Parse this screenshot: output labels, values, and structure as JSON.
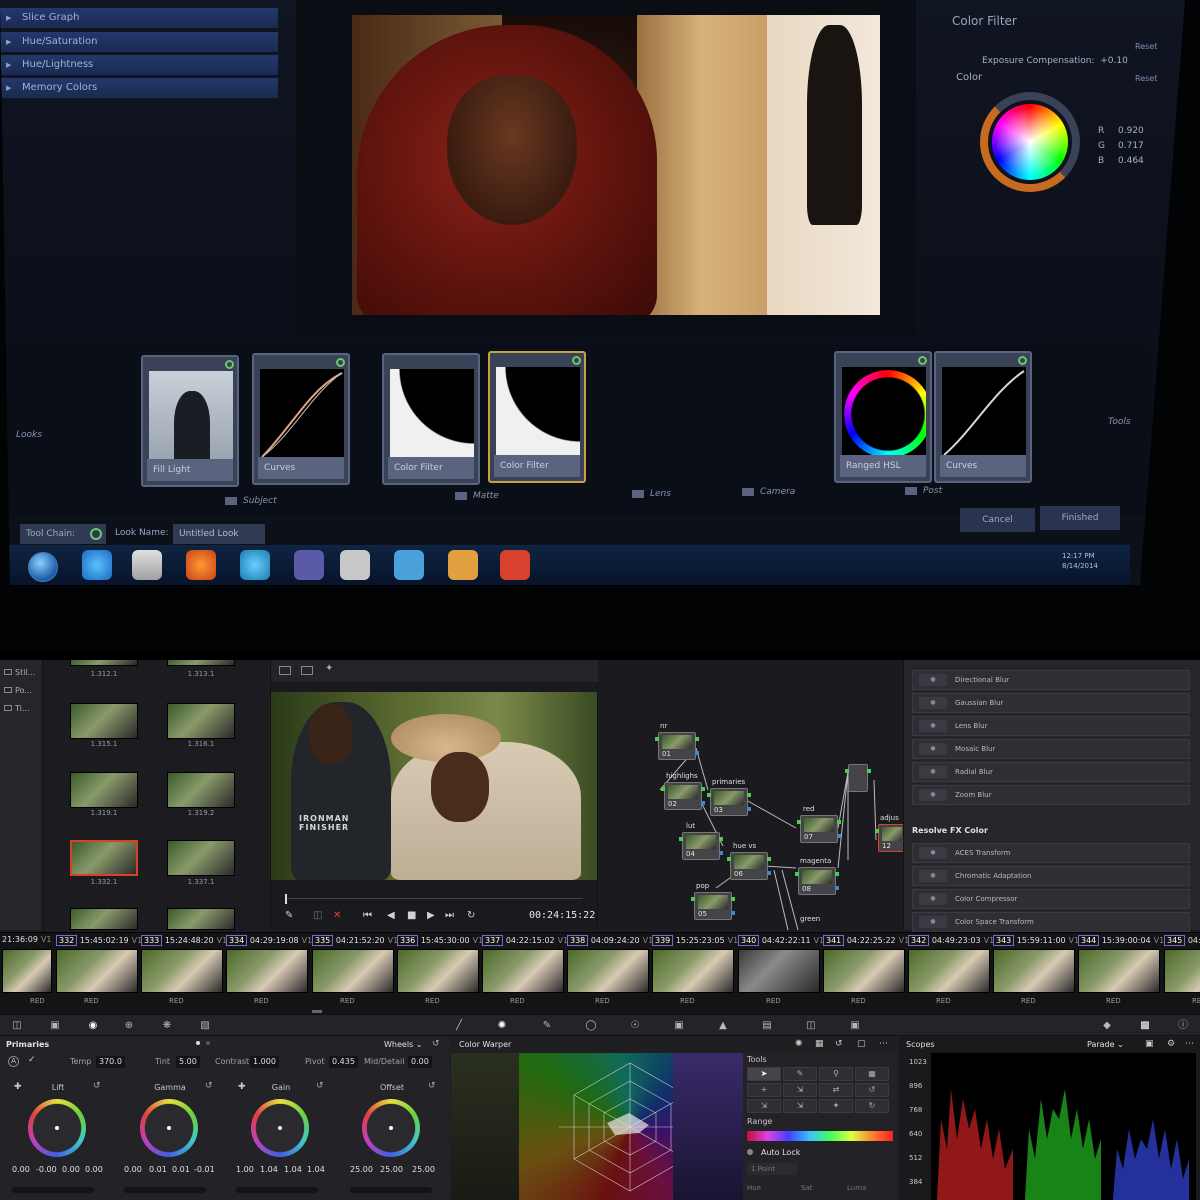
{
  "top_photo": {
    "sidebar_menu": [
      "Slice Graph",
      "Hue/Saturation",
      "Hue/Lightness",
      "Memory Colors"
    ],
    "color_filter": {
      "title": "Color Filter",
      "reset_label": "Reset",
      "exposure_label": "Exposure Compensation:",
      "exposure_value": "+0.10",
      "color_label": "Color",
      "r_label": "R",
      "r_value": "0.920",
      "g_label": "G",
      "g_value": "0.717",
      "b_label": "B",
      "b_value": "0.464"
    },
    "looks_label": "Looks",
    "tools_label": "Tools",
    "tool_cards": [
      "Fill Light",
      "Curves",
      "Color Filter",
      "Color Filter",
      "Ranged HSL",
      "Curves"
    ],
    "groups": [
      "Subject",
      "Matte",
      "Lens",
      "Camera",
      "Post"
    ],
    "tool_chain_label": "Tool Chain:",
    "look_name_label": "Look Name:",
    "look_name_value": "Untitled Look",
    "cancel_label": "Cancel",
    "finished_label": "Finished",
    "clock_time": "12:17 PM",
    "clock_date": "8/14/2014"
  },
  "resolve": {
    "gallery_tabs": [
      "Stil...",
      "Po...",
      "Ti..."
    ],
    "stills": [
      "1.312.1",
      "1.313.1",
      "1.315.1",
      "1.316.1",
      "1.319.1",
      "1.319.2",
      "1.332.1",
      "1.337.1"
    ],
    "viewer": {
      "shirt_text_1": "IRONMAN",
      "shirt_text_2": "FINISHER",
      "timecode": "00:24:15:22"
    },
    "nodes": [
      {
        "label": "nr",
        "num": "01"
      },
      {
        "label": "highlighs",
        "num": "02"
      },
      {
        "label": "primaries",
        "num": "03"
      },
      {
        "label": "lut",
        "num": "04"
      },
      {
        "label": "hue vs",
        "num": "06"
      },
      {
        "label": "pop",
        "num": "05"
      },
      {
        "label": "red",
        "num": "07"
      },
      {
        "label": "magenta",
        "num": "08"
      },
      {
        "label": "green",
        "num": ""
      },
      {
        "label": "adjus",
        "num": "12"
      }
    ],
    "fx_blur": [
      "Directional Blur",
      "Gaussian Blur",
      "Lens Blur",
      "Mosaic Blur",
      "Radial Blur",
      "Zoom Blur"
    ],
    "fx_heading": "Resolve FX Color",
    "fx_color": [
      "ACES Transform",
      "Chromatic Adaptation",
      "Color Compressor",
      "Color Space Transform"
    ],
    "timeline": {
      "first_tc": "21:36:09",
      "track": "V1",
      "codec": "RED",
      "clips": [
        {
          "num": "332",
          "tc": "15:45:02:19"
        },
        {
          "num": "333",
          "tc": "15:24:48:20"
        },
        {
          "num": "334",
          "tc": "04:29:19:08"
        },
        {
          "num": "335",
          "tc": "04:21:52:20"
        },
        {
          "num": "336",
          "tc": "15:45:30:00"
        },
        {
          "num": "337",
          "tc": "04:22:15:02"
        },
        {
          "num": "338",
          "tc": "04:09:24:20"
        },
        {
          "num": "339",
          "tc": "15:25:23:05"
        },
        {
          "num": "340",
          "tc": "04:42:22:11"
        },
        {
          "num": "341",
          "tc": "04:22:25:22"
        },
        {
          "num": "342",
          "tc": "04:49:23:03"
        },
        {
          "num": "343",
          "tc": "15:59:11:00"
        },
        {
          "num": "344",
          "tc": "15:39:00:04"
        },
        {
          "num": "345",
          "tc": "04:4"
        }
      ]
    },
    "primaries": {
      "title": "Primaries",
      "mode": "Wheels",
      "temp_label": "Temp",
      "temp_value": "370.0",
      "tint_label": "Tint",
      "tint_value": "5.00",
      "contrast_label": "Contrast",
      "contrast_value": "1.000",
      "pivot_label": "Pivot",
      "pivot_value": "0.435",
      "middetail_label": "Mid/Detail",
      "middetail_value": "0.00",
      "wheels": [
        {
          "name": "Lift",
          "values": [
            "0.00",
            "-0.00",
            "0.00",
            "0.00"
          ]
        },
        {
          "name": "Gamma",
          "values": [
            "0.00",
            "0.01",
            "0.01",
            "-0.01"
          ]
        },
        {
          "name": "Gain",
          "values": [
            "1.00",
            "1.04",
            "1.04",
            "1.04"
          ]
        },
        {
          "name": "Offset",
          "values": [
            "25.00",
            "25.00",
            "25.00"
          ]
        }
      ]
    },
    "color_warper": {
      "title": "Color Warper",
      "tools_label": "Tools",
      "range_label": "Range",
      "auto_lock_label": "Auto Lock",
      "point_select": "1 Point",
      "hue_label": "Hue",
      "sat_label": "Sat",
      "luma_label": "Luma"
    },
    "scopes": {
      "title": "Scopes",
      "mode": "Parade",
      "ticks": [
        "1023",
        "896",
        "768",
        "640",
        "512",
        "384"
      ]
    }
  }
}
